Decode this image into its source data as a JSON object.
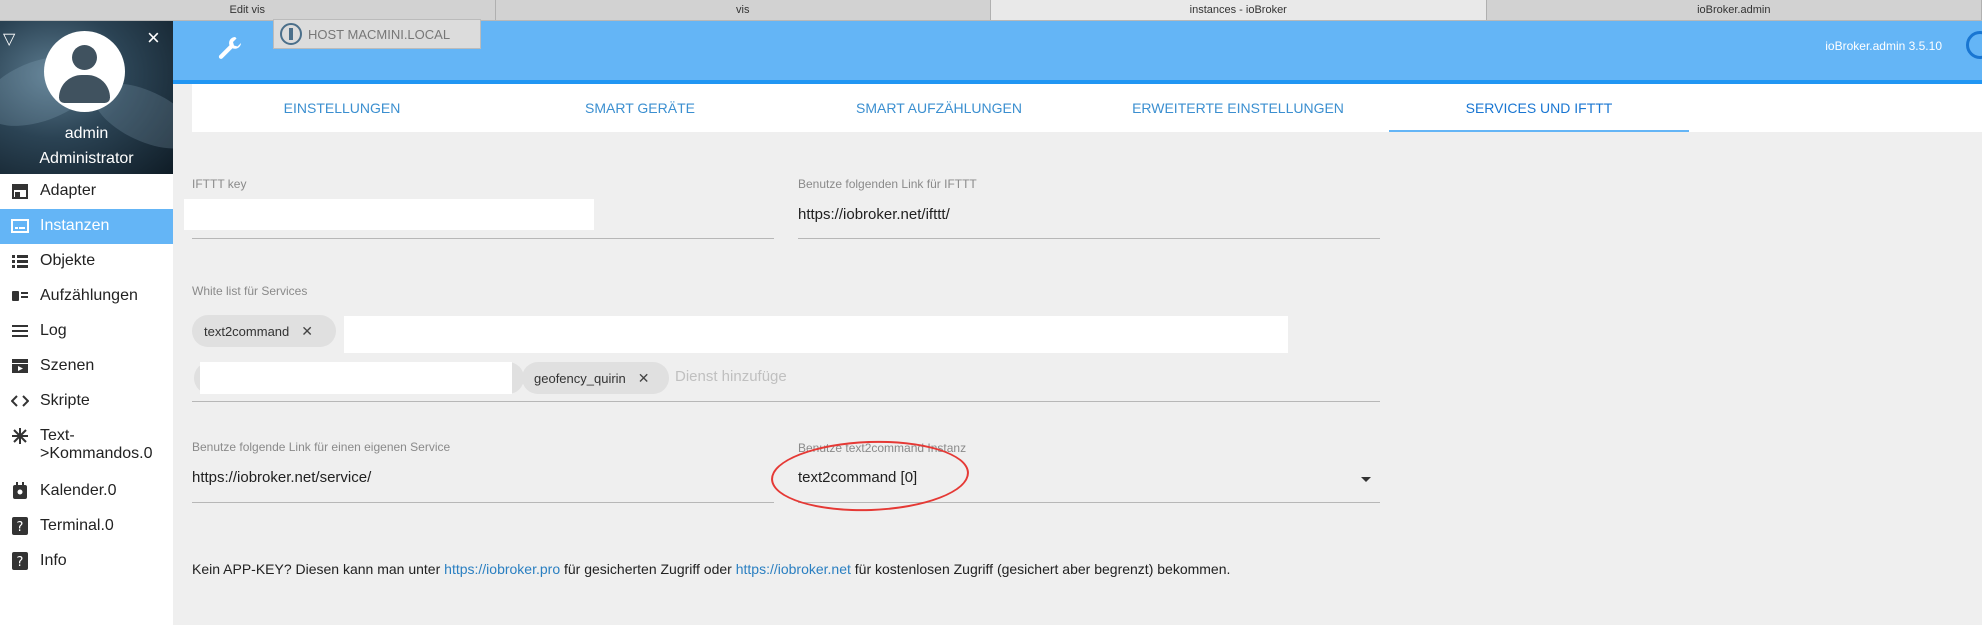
{
  "browser_tabs": [
    "Edit vis",
    "vis",
    "instances - ioBroker",
    "ioBroker.admin"
  ],
  "browser_active_tab": 2,
  "sidebar": {
    "user": "admin",
    "role": "Administrator",
    "items": [
      {
        "label": "Adapter",
        "icon": "adapter-icon"
      },
      {
        "label": "Instanzen",
        "icon": "instances-icon"
      },
      {
        "label": "Objekte",
        "icon": "objects-icon"
      },
      {
        "label": "Aufzählungen",
        "icon": "enums-icon"
      },
      {
        "label": "Log",
        "icon": "log-icon"
      },
      {
        "label": "Szenen",
        "icon": "scenes-icon"
      },
      {
        "label": "Skripte",
        "icon": "scripts-icon"
      },
      {
        "label": "Text-\n>Kommandos.0",
        "icon": "text-commands-icon"
      },
      {
        "label": "Kalender.0",
        "icon": "calendar-icon"
      },
      {
        "label": "Terminal.0",
        "icon": "terminal-icon"
      },
      {
        "label": "Info",
        "icon": "info-icon"
      }
    ]
  },
  "header": {
    "host": "HOST MACMINI.LOCAL",
    "version": "ioBroker.admin 3.5.10"
  },
  "tabs": [
    "EINSTELLUNGEN",
    "SMART GERÄTE",
    "SMART AUFZÄHLUNGEN",
    "ERWEITERTE EINSTELLUNGEN",
    "SERVICES UND IFTTT"
  ],
  "form": {
    "ifttt_key_label": "IFTTT key",
    "ifttt_key_value": "",
    "ifttt_link_label": "Benutze folgenden Link für IFTTT",
    "ifttt_link_value": "https://iobroker.net/ifttt/",
    "whitelist_label": "White list für Services",
    "whitelist_chips": [
      "text2command",
      "geofency_quirin"
    ],
    "whitelist_placeholder": "Dienst hinzufüge",
    "service_link_label": "Benutze folgende Link für einen eigenen Service",
    "service_link_value": "https://iobroker.net/service/",
    "instance_label": "Benutze text2command Instanz",
    "instance_value": "text2command [0]"
  },
  "note": {
    "prefix": "Kein APP-KEY? Diesen kann man unter ",
    "link1": "https://iobroker.pro",
    "middle": " für gesicherten Zugriff oder ",
    "link2": "https://iobroker.net",
    "suffix": " für kostenlosen Zugriff (gesichert aber begrenzt) bekommen."
  }
}
